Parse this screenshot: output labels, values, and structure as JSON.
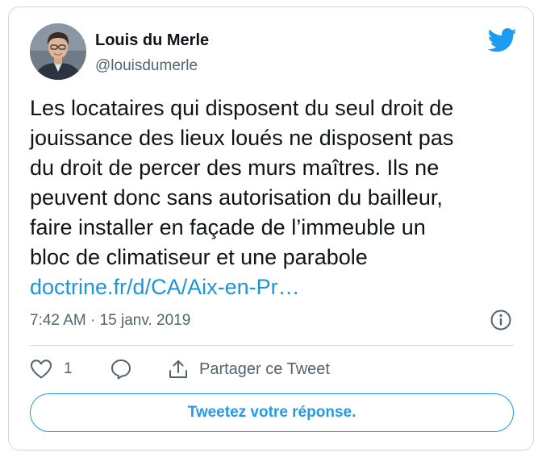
{
  "author": {
    "name": "Louis du Merle",
    "handle": "@louisdumerle",
    "avatar_icon": "profile-photo"
  },
  "tweet": {
    "text": "Les locataires qui disposent du seul droit de\njouissance des lieux loués ne disposent pas\ndu droit de percer des murs maîtres. Ils ne\npeuvent donc sans autorisation du bailleur,\nfaire installer en façade de l’immeuble un\nbloc de climatiseur et une parabole",
    "link": "doctrine.fr/d/CA/Aix-en-Pr…",
    "timestamp": "7:42 AM · 15 janv. 2019"
  },
  "actions": {
    "like_count": "1",
    "share_label": "Partager ce Tweet"
  },
  "reply_button_label": "Tweetez votre réponse.",
  "colors": {
    "brand_blue": "#1d9bf0",
    "link_blue": "#1b95e0",
    "text": "#0f1419",
    "secondary_text": "#536471",
    "border": "#cfd9de"
  }
}
